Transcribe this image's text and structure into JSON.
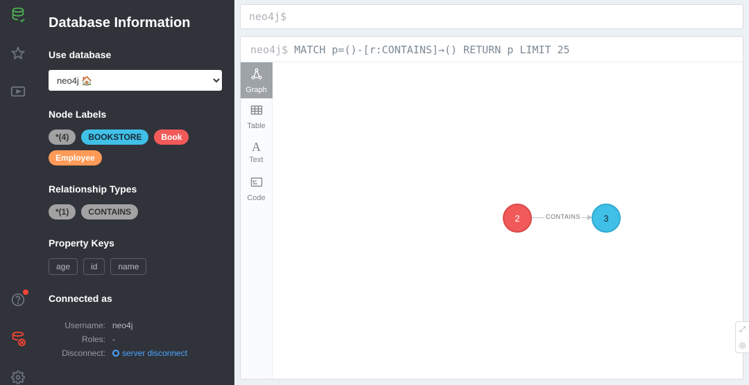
{
  "rail": {
    "icons": [
      "database-icon",
      "star-icon",
      "play-icon",
      "help-icon",
      "disconnect-icon",
      "gear-icon"
    ]
  },
  "sidebar": {
    "title": "Database Information",
    "use_database": {
      "label": "Use database",
      "selected": "neo4j 🏠"
    },
    "node_labels": {
      "label": "Node Labels",
      "chips": [
        {
          "text": "*(4)",
          "cls": "gray"
        },
        {
          "text": "BOOKSTORE",
          "cls": "blue"
        },
        {
          "text": "Book",
          "cls": "red"
        },
        {
          "text": "Employee",
          "cls": "orange"
        }
      ]
    },
    "rel_types": {
      "label": "Relationship Types",
      "chips": [
        {
          "text": "*(1)",
          "cls": "gray"
        },
        {
          "text": "CONTAINS",
          "cls": "gray"
        }
      ]
    },
    "prop_keys": {
      "label": "Property Keys",
      "keys": [
        "age",
        "id",
        "name"
      ]
    },
    "connected": {
      "label": "Connected as",
      "username_label": "Username:",
      "username_value": "neo4j",
      "roles_label": "Roles:",
      "roles_value": "-",
      "disconnect_label": "Disconnect:",
      "disconnect_link": "server disconnect"
    }
  },
  "editor": {
    "prompt": "neo4j$"
  },
  "result": {
    "prompt": "neo4j$",
    "query": "MATCH p=()-[r:CONTAINS]→() RETURN p LIMIT 25",
    "tabs": {
      "graph": "Graph",
      "table": "Table",
      "text": "Text",
      "code": "Code"
    },
    "graph": {
      "edge_label": "CONTAINS",
      "nodes": [
        {
          "id": 2,
          "label": "2",
          "color": "red"
        },
        {
          "id": 3,
          "label": "3",
          "color": "blue"
        }
      ]
    }
  }
}
